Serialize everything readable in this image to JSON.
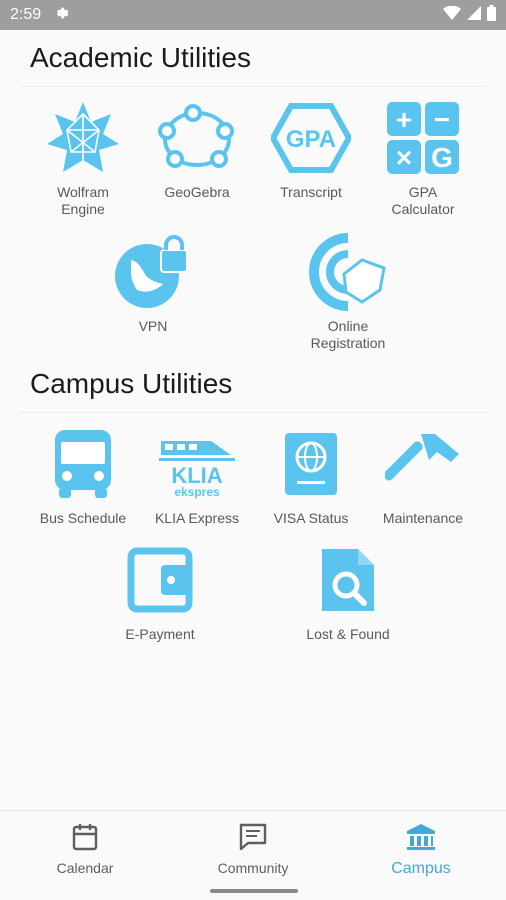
{
  "status_bar": {
    "time": "2:59"
  },
  "colors": {
    "accent": "#5BC4EE",
    "status_bar": "#9E9E9E",
    "active_tab": "#42A9D6"
  },
  "sections": {
    "academic": {
      "title": "Academic Utilities",
      "items": [
        {
          "label": "Wolfram\nEngine",
          "icon": "wolfram-icon"
        },
        {
          "label": "GeoGebra",
          "icon": "geogebra-icon"
        },
        {
          "label": "Transcript",
          "icon": "gpa-hexagon-icon"
        },
        {
          "label": "GPA\nCalculator",
          "icon": "calculator-icon"
        },
        {
          "label": "VPN",
          "icon": "vpn-globe-lock-icon"
        },
        {
          "label": "Online\nRegistration",
          "icon": "registration-icon"
        }
      ]
    },
    "campus": {
      "title": "Campus Utilities",
      "items": [
        {
          "label": "Bus Schedule",
          "icon": "bus-icon"
        },
        {
          "label": "KLIA Express",
          "icon": "klia-express-icon"
        },
        {
          "label": "VISA Status",
          "icon": "passport-icon"
        },
        {
          "label": "Maintenance",
          "icon": "hammer-icon"
        },
        {
          "label": "E-Payment",
          "icon": "wallet-icon"
        },
        {
          "label": "Lost & Found",
          "icon": "search-document-icon"
        }
      ]
    }
  },
  "klia_logo": {
    "line1": "KLIA",
    "line2": "ekspres"
  },
  "gpa_icon_text": "GPA",
  "calculator_icon_keys": [
    "+",
    "−",
    "×",
    "G"
  ],
  "bottom_nav": [
    {
      "label": "Calendar",
      "icon": "calendar-icon",
      "active": false
    },
    {
      "label": "Community",
      "icon": "chat-icon",
      "active": false
    },
    {
      "label": "Campus",
      "icon": "bank-icon",
      "active": true
    }
  ]
}
